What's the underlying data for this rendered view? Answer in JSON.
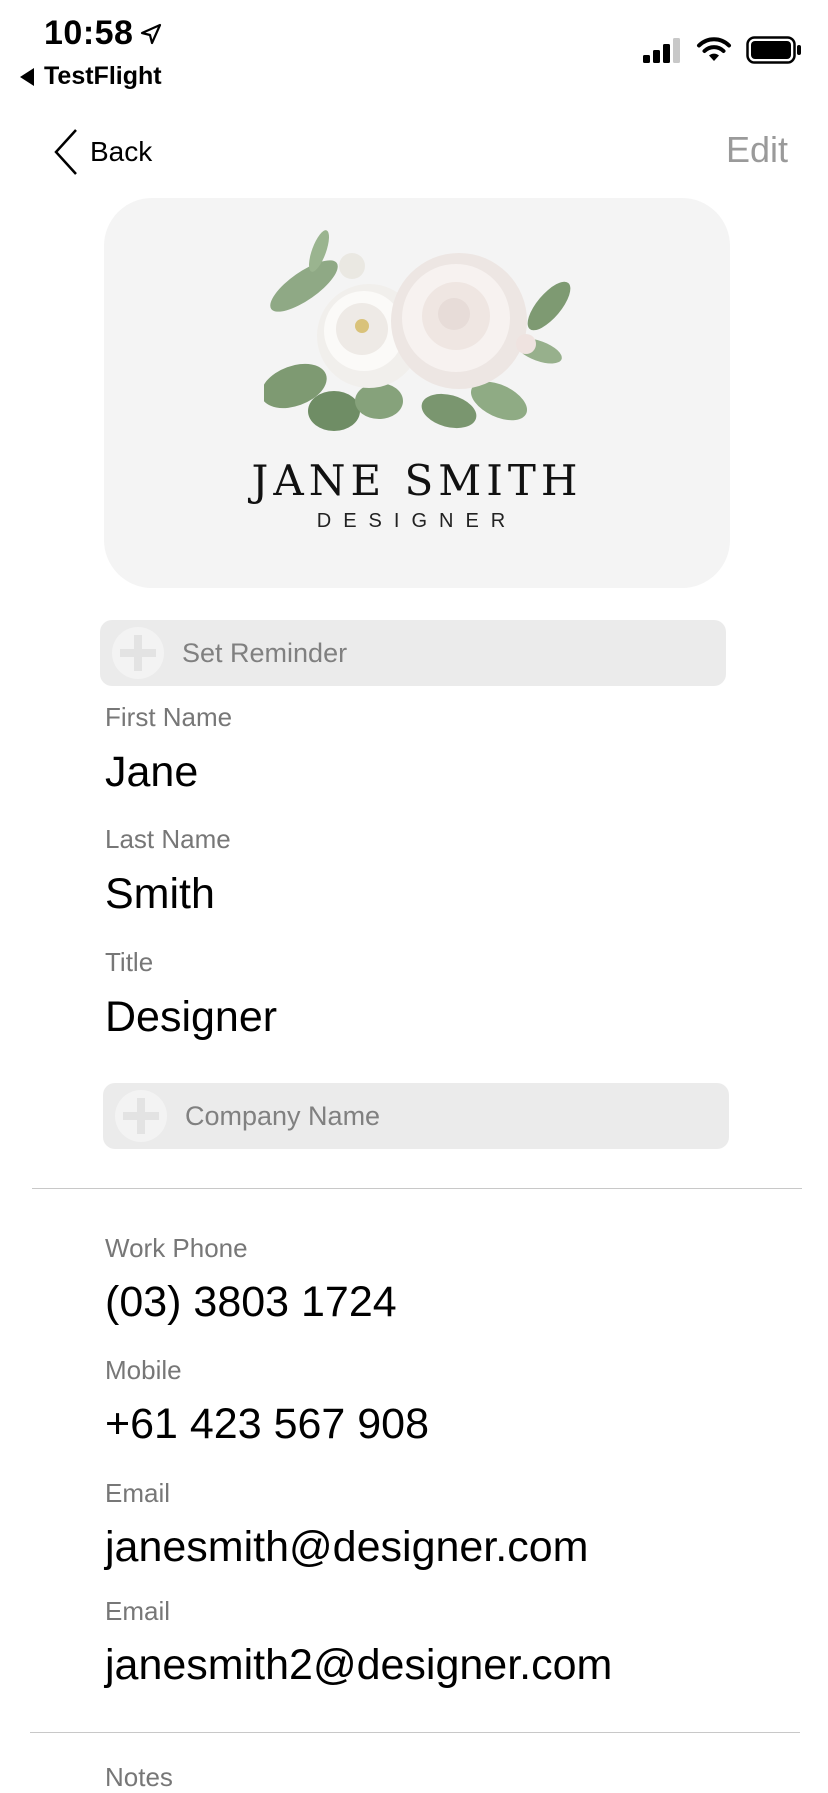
{
  "status_bar": {
    "time": "10:58",
    "back_app": "TestFlight"
  },
  "nav": {
    "back_label": "Back",
    "edit_label": "Edit"
  },
  "card": {
    "name": "JANE SMITH",
    "role": "DESIGNER"
  },
  "actions": {
    "set_reminder": "Set Reminder",
    "company_name": "Company Name"
  },
  "fields": {
    "first_name": {
      "label": "First Name",
      "value": "Jane"
    },
    "last_name": {
      "label": "Last Name",
      "value": "Smith"
    },
    "title": {
      "label": "Title",
      "value": "Designer"
    },
    "work_phone": {
      "label": "Work Phone",
      "value": "(03) 3803 1724"
    },
    "mobile": {
      "label": "Mobile",
      "value": "+61 423 567 908"
    },
    "email_1": {
      "label": "Email",
      "value": "janesmith@designer.com"
    },
    "email_2": {
      "label": "Email",
      "value": "janesmith2@designer.com"
    },
    "notes": {
      "label": "Notes"
    }
  },
  "colors": {
    "card_bg": "#f4f4f4",
    "pill_bg": "#ebebeb",
    "label_gray": "#777777",
    "edit_gray": "#9a9a9a"
  }
}
